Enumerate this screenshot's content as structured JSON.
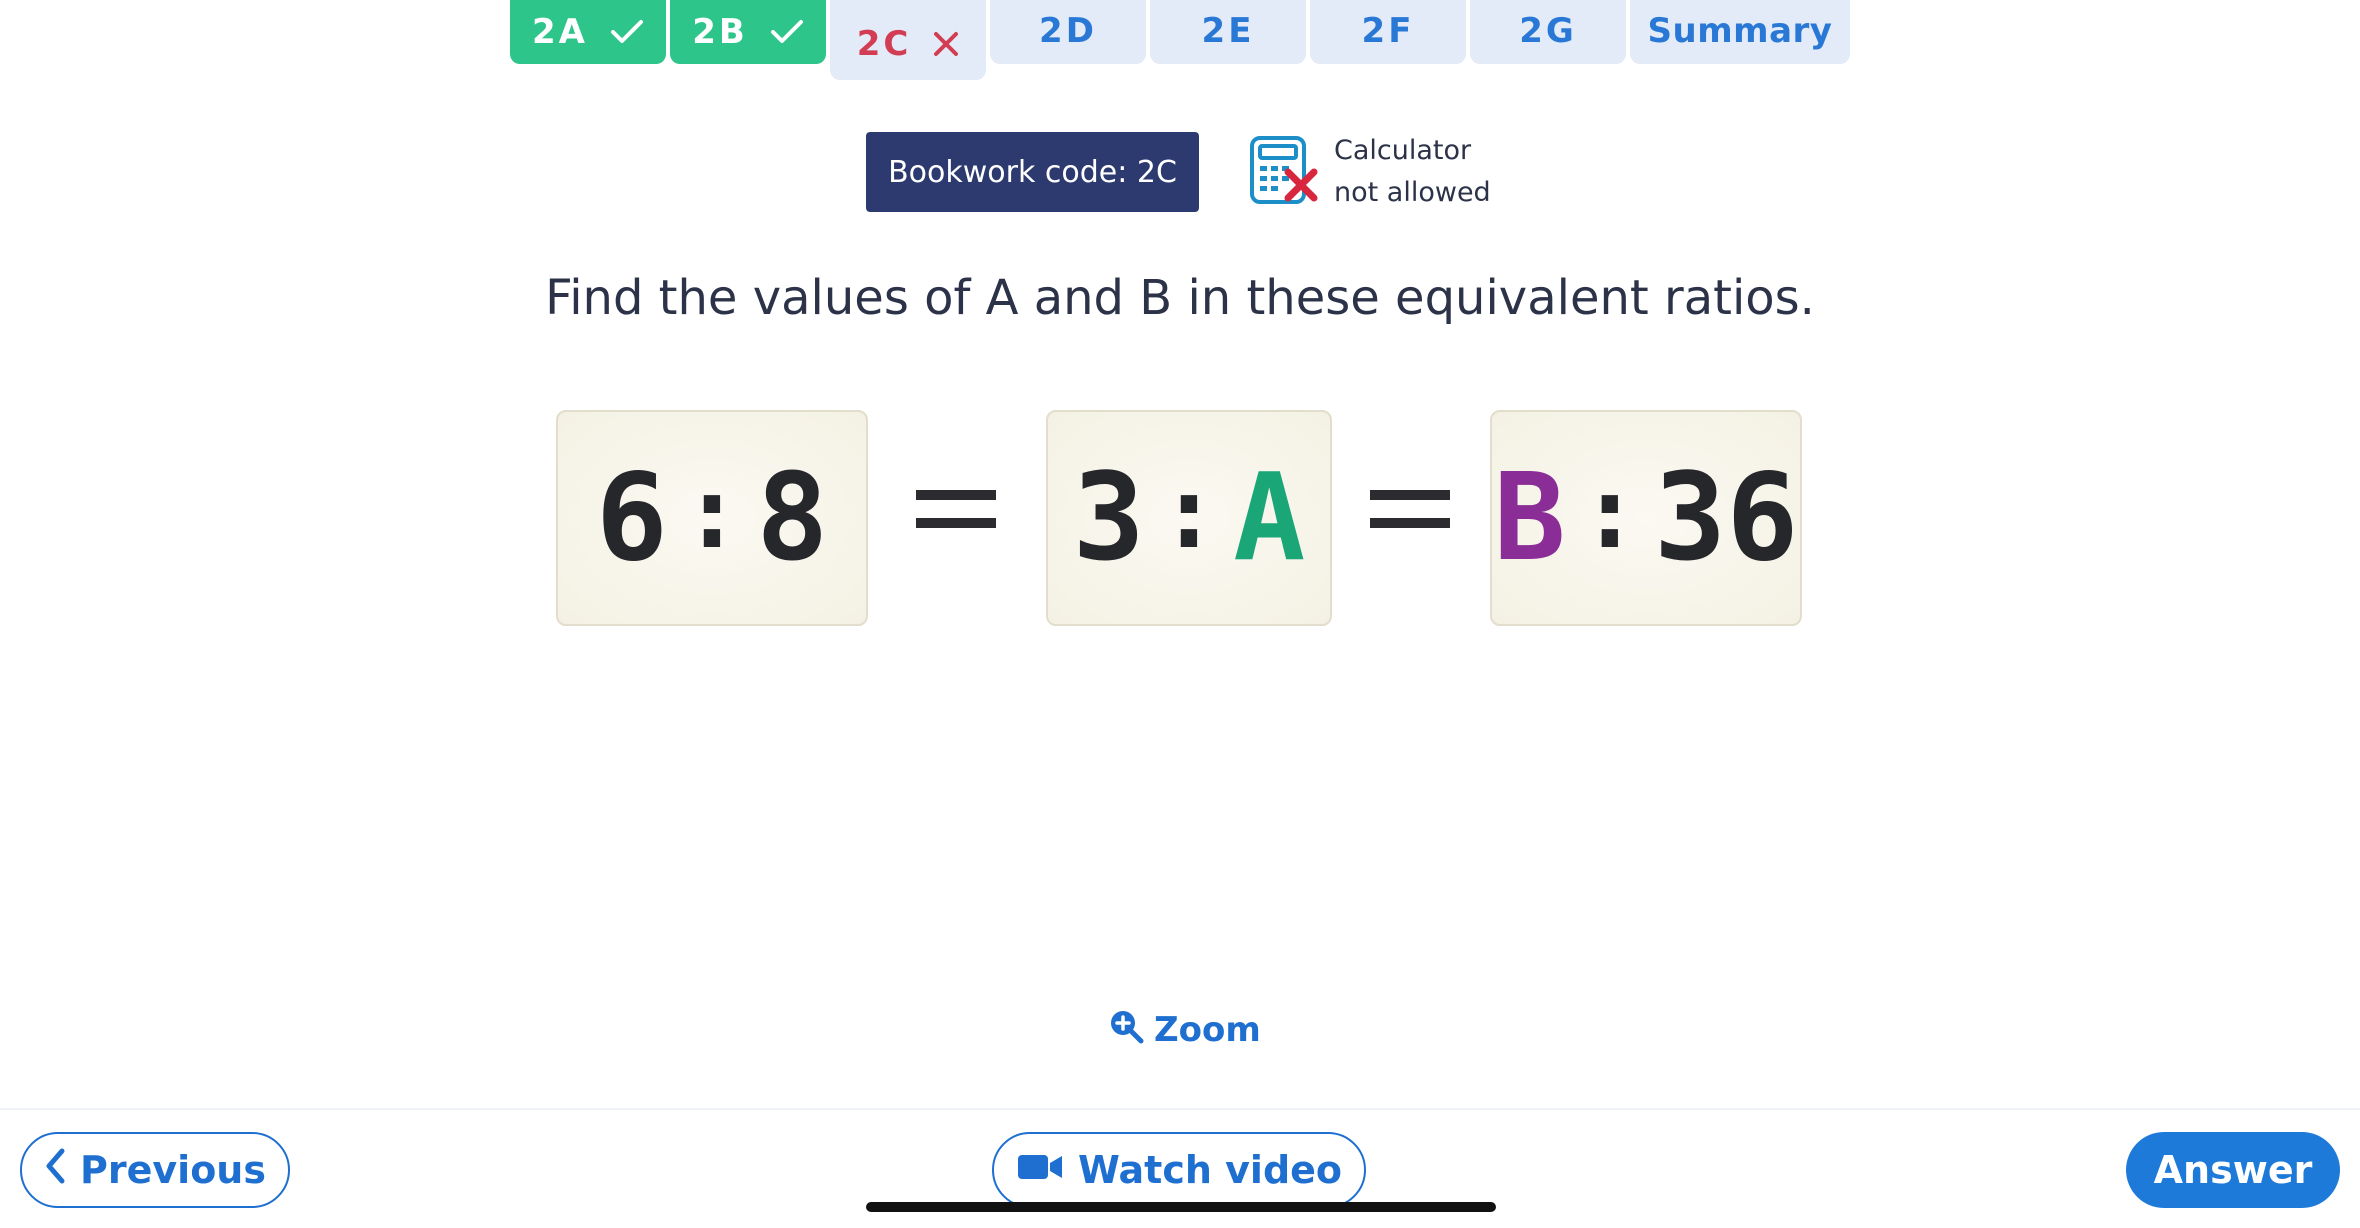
{
  "tabs": [
    {
      "label": "2A",
      "status": "correct",
      "icon": "check-icon"
    },
    {
      "label": "2B",
      "status": "correct",
      "icon": "check-icon"
    },
    {
      "label": "2C",
      "status": "incorrect",
      "icon": "cross-icon"
    },
    {
      "label": "2D",
      "status": "pending"
    },
    {
      "label": "2E",
      "status": "pending"
    },
    {
      "label": "2F",
      "status": "pending"
    },
    {
      "label": "2G",
      "status": "pending"
    },
    {
      "label": "Summary",
      "status": "pending"
    }
  ],
  "bookwork": {
    "label": "Bookwork code: 2C"
  },
  "calculator": {
    "line1": "Calculator",
    "line2": "not allowed",
    "icon": "calculator-not-allowed-icon"
  },
  "question": {
    "text": "Find the values of A and B in these equivalent ratios."
  },
  "ratios": [
    {
      "left": "6",
      "right": "8"
    },
    {
      "left": "3",
      "right": "A"
    },
    {
      "left": "B",
      "right": "36"
    }
  ],
  "equals": "=",
  "zoom": {
    "label": "Zoom",
    "icon": "zoom-in-icon"
  },
  "buttons": {
    "previous": "Previous",
    "watch_video": "Watch video",
    "answer": "Answer"
  },
  "colors": {
    "correct_tab": "#2dc58a",
    "current_tab_text": "#d23d53",
    "pending_tab_text": "#2a78d6",
    "bookwork_bg": "#2c3a70",
    "unknown_a": "#1aa677",
    "unknown_b": "#8a2d97",
    "primary_blue": "#1e7ad8"
  }
}
